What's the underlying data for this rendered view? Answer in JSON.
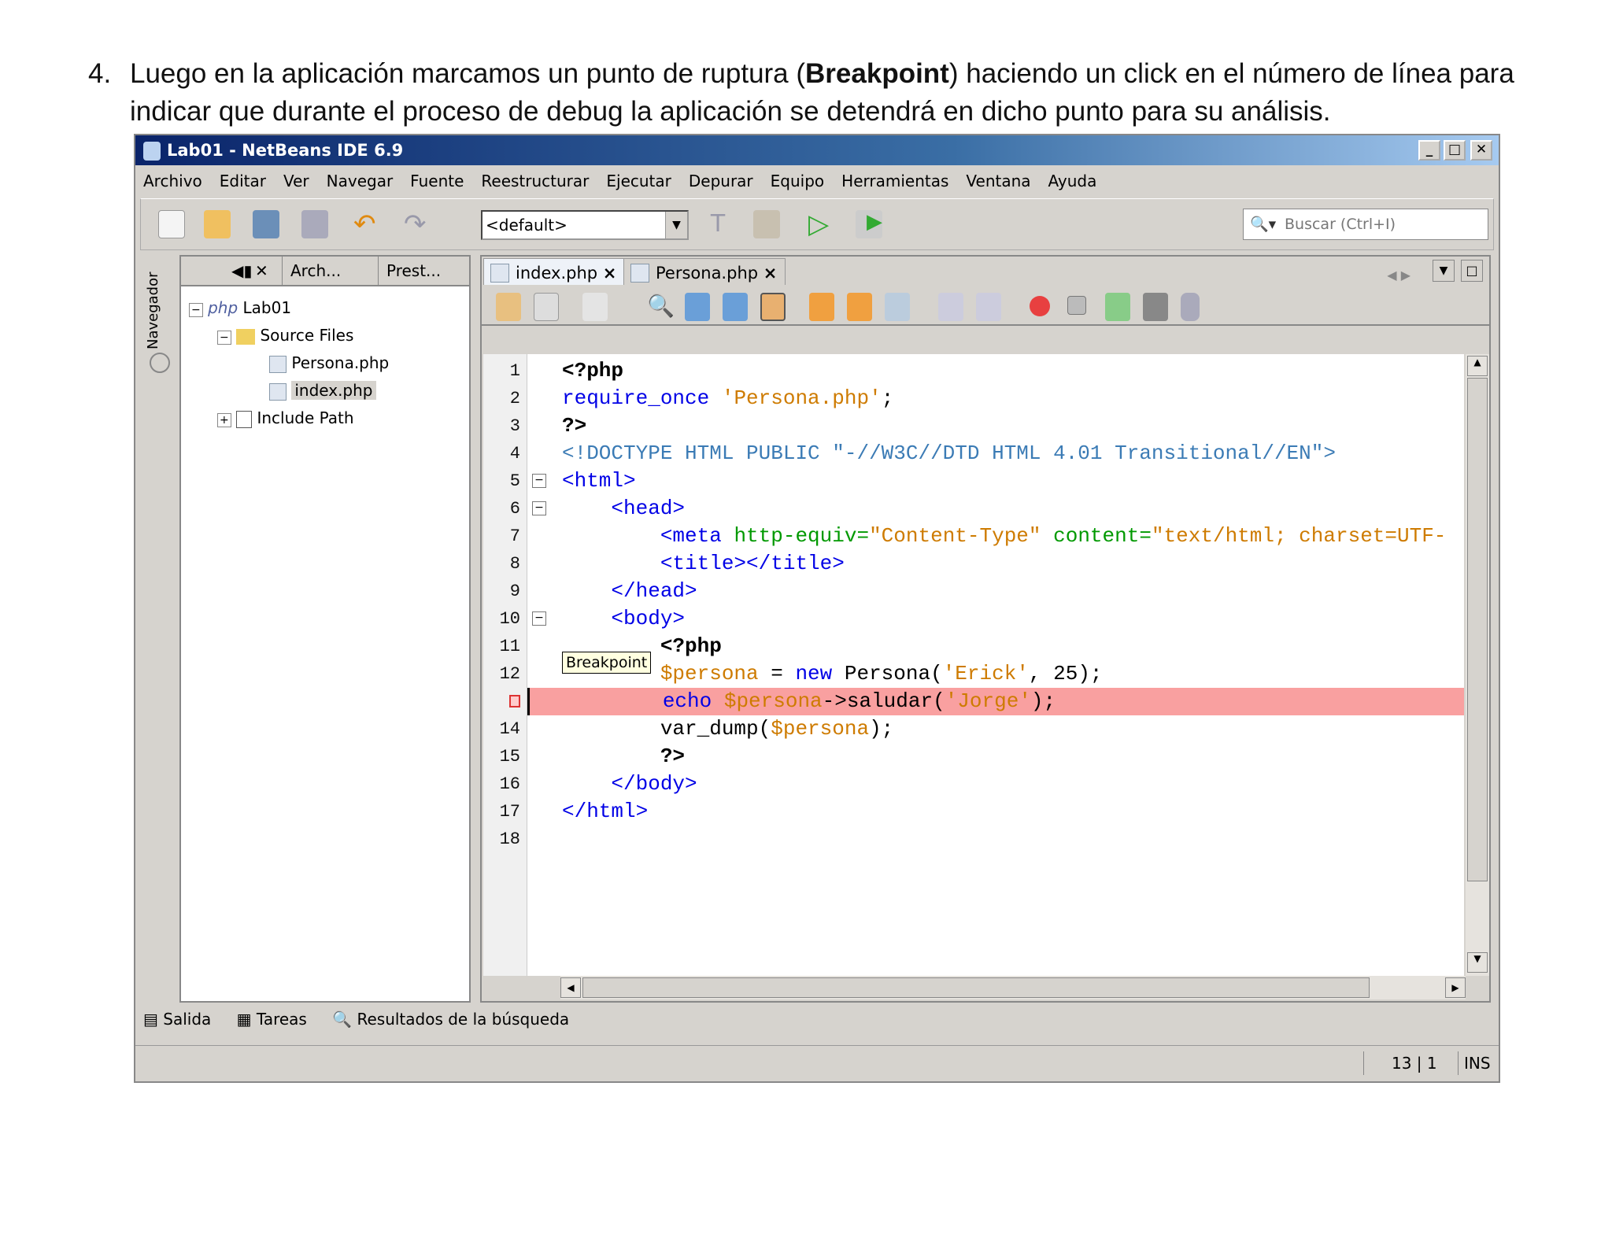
{
  "instruction": {
    "number": "4.",
    "text_before": "Luego en la aplicación marcamos un punto de ruptura (",
    "bold": "Breakpoint",
    "text_after": ") haciendo un click en el número de línea para indicar que durante el proceso de debug la aplicación se detendrá en dicho punto para su análisis."
  },
  "window": {
    "title": "Lab01 - NetBeans IDE 6.9",
    "controls": [
      "_",
      "□",
      "✕"
    ]
  },
  "menu": [
    "Archivo",
    "Editar",
    "Ver",
    "Navegar",
    "Fuente",
    "Reestructurar",
    "Ejecutar",
    "Depurar",
    "Equipo",
    "Herramientas",
    "Ventana",
    "Ayuda"
  ],
  "toolbar": {
    "config": "<default>",
    "search_placeholder": "Buscar (Ctrl+I)"
  },
  "navigator": {
    "label": "Navegador"
  },
  "left_tabs": [
    "Arch...",
    "Prest..."
  ],
  "tree": [
    {
      "label": "Lab01"
    },
    {
      "label": "Source Files"
    },
    {
      "label": "Persona.php"
    },
    {
      "label": "index.php"
    },
    {
      "label": "Include Path"
    }
  ],
  "editor_tabs": [
    "index.php",
    "Persona.php"
  ],
  "tooltip": "Breakpoint",
  "line_numbers": [
    "1",
    "2",
    "3",
    "4",
    "5",
    "6",
    "7",
    "8",
    "9",
    "10",
    "11",
    "12",
    "",
    "14",
    "15",
    "16",
    "17",
    "18"
  ],
  "code": [
    [
      "<?php"
    ],
    [
      "require_once",
      " ",
      "'Persona.php'",
      ";"
    ],
    [
      "?>"
    ],
    [
      "<!DOCTYPE HTML PUBLIC \"-//W3C//DTD HTML 4.01 Transitional//EN\">"
    ],
    [
      "<html>"
    ],
    [
      "    <head>"
    ],
    [
      "        <meta",
      " http-equiv=",
      "\"Content-Type\"",
      " content=",
      "\"text/html; charset=UTF-"
    ],
    [
      "        <title></title>"
    ],
    [
      "    </head>"
    ],
    [
      "    <body>"
    ],
    [
      "        <?php"
    ],
    [
      "        $persona",
      " = ",
      "new",
      " Persona(",
      "'Erick'",
      ", 25);"
    ],
    [
      "        echo",
      " $persona",
      "->saludar(",
      "'Jorge'",
      ");"
    ],
    [
      "        var_dump(",
      "$persona",
      ");"
    ],
    [
      "        ?>"
    ],
    [
      "    </body>"
    ],
    [
      "</html>"
    ],
    [
      ""
    ]
  ],
  "bottom_tabs": [
    "Salida",
    "Tareas",
    "Resultados de la búsqueda"
  ],
  "status": {
    "position": "13 | 1",
    "mode": "INS"
  },
  "colors": {
    "breakpoint_line": "#f9a0a0",
    "title_bar": "#0a246a"
  }
}
